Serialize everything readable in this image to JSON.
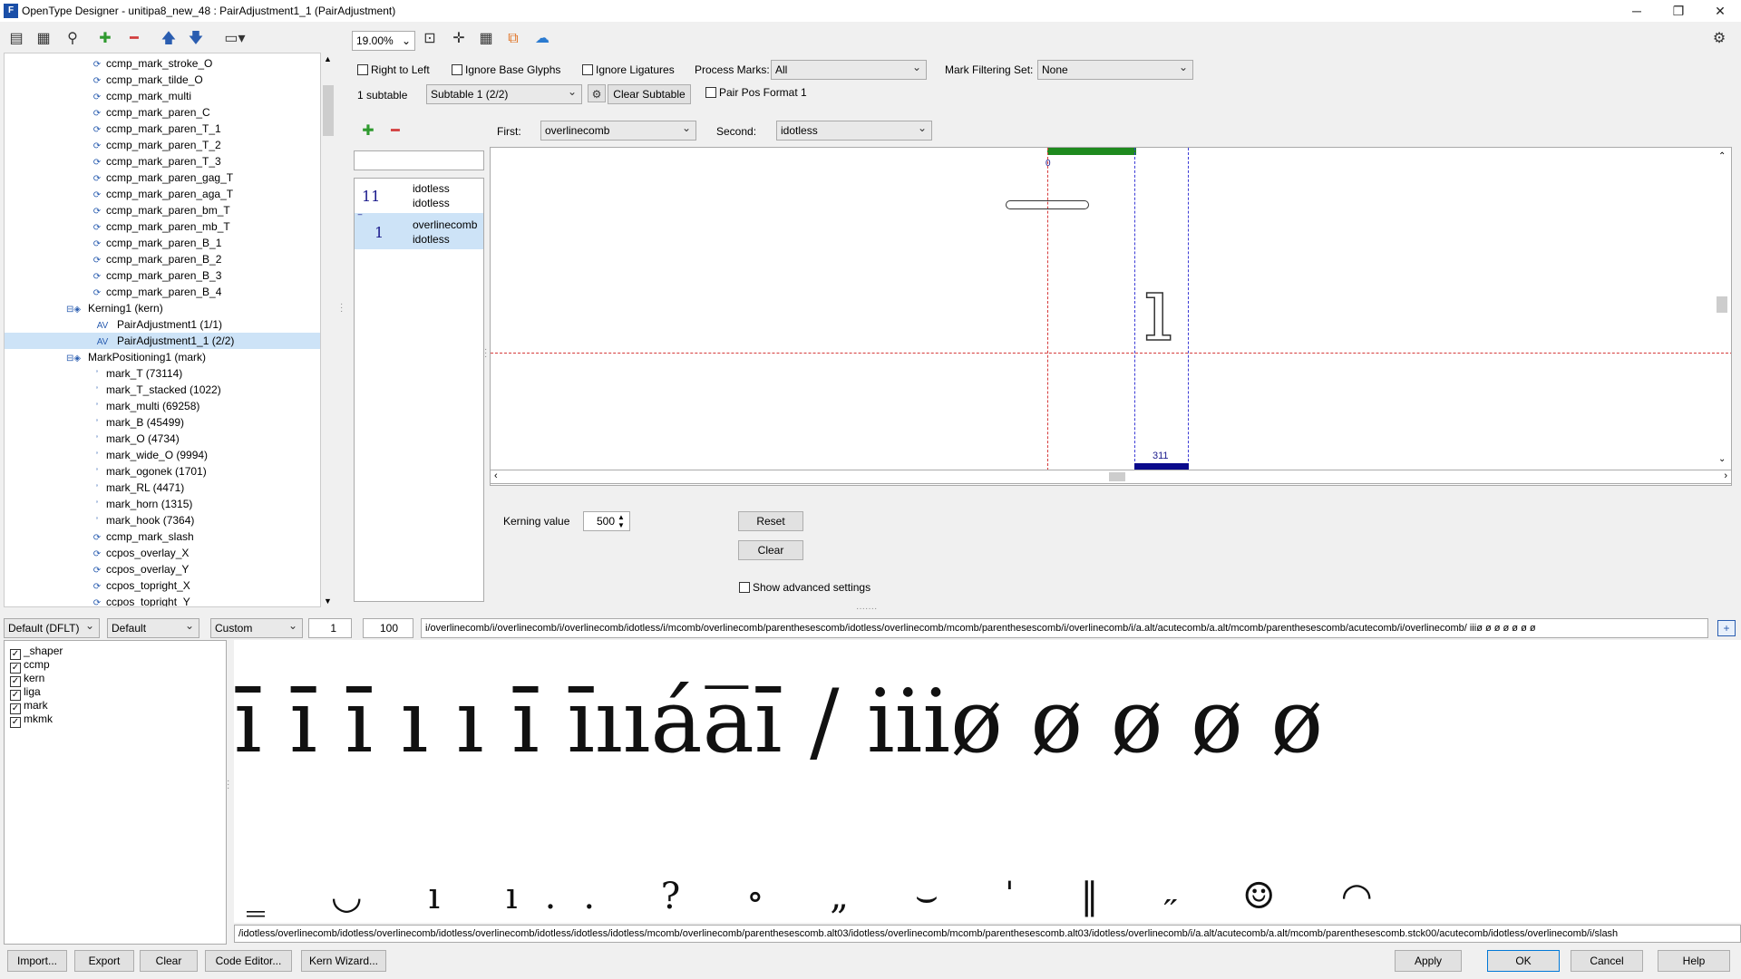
{
  "window": {
    "title": "OpenType Designer - unitipa8_new_48 : PairAdjustment1_1 (PairAdjustment)",
    "icon": "app-icon",
    "minimize_glyph": "─",
    "maximize_glyph": "❐",
    "close_glyph": "✕"
  },
  "toolbar": {
    "zoom": "19.00%",
    "add_glyph": "✚",
    "remove_glyph": "━",
    "up_glyph": "🡅",
    "down_glyph": "🡇",
    "settings_glyph": "⚙"
  },
  "tree": {
    "items": [
      {
        "label": "ccmp_mark_stroke_O"
      },
      {
        "label": "ccmp_mark_tilde_O"
      },
      {
        "label": "ccmp_mark_multi"
      },
      {
        "label": "ccmp_mark_paren_C"
      },
      {
        "label": "ccmp_mark_paren_T_1"
      },
      {
        "label": "ccmp_mark_paren_T_2"
      },
      {
        "label": "ccmp_mark_paren_T_3"
      },
      {
        "label": "ccmp_mark_paren_gag_T"
      },
      {
        "label": "ccmp_mark_paren_aga_T"
      },
      {
        "label": "ccmp_mark_paren_bm_T"
      },
      {
        "label": "ccmp_mark_paren_mb_T"
      },
      {
        "label": "ccmp_mark_paren_B_1"
      },
      {
        "label": "ccmp_mark_paren_B_2"
      },
      {
        "label": "ccmp_mark_paren_B_3"
      },
      {
        "label": "ccmp_mark_paren_B_4"
      },
      {
        "label": "Kerning1 (kern)"
      },
      {
        "label": "PairAdjustment1 (1/1)"
      },
      {
        "label": "PairAdjustment1_1 (2/2)"
      },
      {
        "label": "MarkPositioning1 (mark)"
      },
      {
        "label": "mark_T (73114)"
      },
      {
        "label": "mark_T_stacked (1022)"
      },
      {
        "label": "mark_multi (69258)"
      },
      {
        "label": "mark_B (45499)"
      },
      {
        "label": "mark_O (4734)"
      },
      {
        "label": "mark_wide_O (9994)"
      },
      {
        "label": "mark_ogonek (1701)"
      },
      {
        "label": "mark_RL (4471)"
      },
      {
        "label": "mark_horn (1315)"
      },
      {
        "label": "mark_hook (7364)"
      },
      {
        "label": "ccmp_mark_slash"
      },
      {
        "label": "ccpos_overlay_X"
      },
      {
        "label": "ccpos_overlay_Y"
      },
      {
        "label": "ccpos_topright_X"
      },
      {
        "label": "ccpos_topright_Y"
      }
    ],
    "kern_icon": "AV",
    "mark_icon": "ʼ"
  },
  "options": {
    "right_to_left": "Right to Left",
    "ignore_base": "Ignore Base Glyphs",
    "ignore_lig": "Ignore Ligatures",
    "process_marks_label": "Process Marks:",
    "process_marks_value": "All",
    "mark_filter_label": "Mark Filtering Set:",
    "mark_filter_value": "None",
    "subtable_count": "1 subtable",
    "subtable_value": "Subtable 1 (2/2)",
    "clear_subtable": "Clear Subtable",
    "pair_pos_format": "Pair Pos Format 1",
    "first_label": "First:",
    "first_value": "overlinecomb",
    "second_label": "Second:",
    "second_value": "idotless"
  },
  "pairs": [
    {
      "count": "11",
      "first": "idotless",
      "second": "idotless",
      "selected": false
    },
    {
      "count": "1",
      "first": "overlinecomb",
      "second": "idotless",
      "selected": true
    }
  ],
  "preview": {
    "origin_label": "0",
    "advance_label": "311",
    "glyph": "ı"
  },
  "kerning": {
    "label": "Kerning value",
    "value": "500",
    "reset": "Reset",
    "clear": "Clear",
    "advanced": "Show advanced settings"
  },
  "bottom_controls": {
    "script": "Default (DFLT)",
    "language": "Default",
    "mode": "Custom",
    "count": "1",
    "size": "100",
    "input_text": "i/overlinecomb/i/overlinecomb/i/overlinecomb/idotless/i/mcomb/overlinecomb/parenthesescomb/idotless/overlinecomb/mcomb/parenthesescomb/i/overlinecomb/i/a.alt/acutecomb/a.alt/mcomb/parenthesescomb/acutecomb/i/overlinecomb/ iiiø ø ø ø ø ø ø ",
    "plus_btn": "+"
  },
  "features": [
    {
      "label": "_shaper",
      "checked": true
    },
    {
      "label": "ccmp",
      "checked": true
    },
    {
      "label": "kern",
      "checked": true
    },
    {
      "label": "liga",
      "checked": true
    },
    {
      "label": "mark",
      "checked": true
    },
    {
      "label": "mkmk",
      "checked": true
    }
  ],
  "render_line": {
    "main": "ı̄ ı̄ ı̄ ı ı  ı̄ ı̄ııáa̅ı̄ / iiiø ø ø ø ø",
    "marks": "‗ ◡ ı ı.. ? ∘ „ ⌣ ˈ ‖ ˶ ☺ ◠",
    "status": "/idotless/overlinecomb/idotless/overlinecomb/idotless/overlinecomb/idotless/idotless/idotless/mcomb/overlinecomb/parenthesescomb.alt03/idotless/overlinecomb/mcomb/parenthesescomb.alt03/idotless/overlinecomb/i/a.alt/acutecomb/a.alt/mcomb/parenthesescomb.stck00/acutecomb/idotless/overlinecomb/i/slash"
  },
  "buttons": {
    "import": "Import...",
    "export": "Export",
    "clear": "Clear",
    "code_editor": "Code Editor...",
    "kern_wizard": "Kern Wizard...",
    "apply": "Apply",
    "ok": "OK",
    "cancel": "Cancel",
    "help": "Help"
  },
  "colors": {
    "selection": "#cde3f7",
    "green_bar": "#1e8a1e",
    "blue_bar": "#0a0a8c",
    "red_guide": "#d63a3a",
    "blue_guide": "#3a3ad6"
  }
}
